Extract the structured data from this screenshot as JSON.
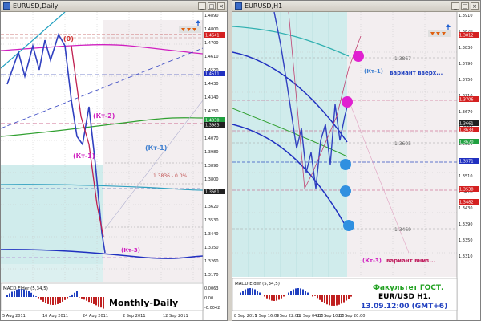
{
  "left_window": {
    "title": "EURUSD,Daily",
    "buttons": [
      "_",
      "□",
      "×"
    ],
    "label_0": "(0)",
    "label_kt2": "(Кт-2)",
    "label_kt1": "(Кт-1)",
    "label_kt1_blue": "(Кт-1)",
    "label_kt3": "(Кт-3)",
    "level_note": "1.3836 - 0.0%",
    "macd_label": "MACD Elder (5,34,5)",
    "caption": "Monthly-Daily",
    "price_ticks": [
      "1.4890",
      "1.4800",
      "1.4700",
      "1.4610",
      "1.4520",
      "1.4430",
      "1.4340",
      "1.4250",
      "1.4160",
      "1.4070",
      "1.3980",
      "1.3890",
      "1.3800",
      "1.3710",
      "1.3620",
      "1.3530",
      "1.3440",
      "1.3350",
      "1.3260",
      "1.3170"
    ],
    "price_badges": [
      {
        "text": "1.4641",
        "color": "#d42020"
      },
      {
        "text": "1.4511",
        "color": "#2030c0"
      },
      {
        "text": "1.4030",
        "color": "#20a040"
      },
      {
        "text": "1.3983",
        "color": "#202020"
      },
      {
        "text": "1.3661",
        "color": "#202020"
      }
    ],
    "macd_ticks": [
      "0.0063",
      "0.00",
      "-0.0042"
    ],
    "date_ticks": [
      "5 Aug 2011",
      "16 Aug 2011",
      "24 Aug 2011",
      "2 Sep 2011",
      "12 Sep 2011"
    ]
  },
  "right_window": {
    "title": "EURUSD,H1",
    "buttons": [
      "_",
      "□",
      "×"
    ],
    "label_kt1": "(Кт-1)",
    "label_variant_up": "вариант вверх...",
    "label_variant_down": "вариант вниз...",
    "label_kt3": "(Кт-3)",
    "level_3867": "1.3867",
    "level_3605": "1.3605",
    "level_3469": "1.3469",
    "macd_label": "MACD Elder (5,34,5)",
    "caption_line1": "Факультет ГОСТ.",
    "caption_line2": "EUR/USD H1.",
    "caption_line3": "13.09.12:00 (GMT+6)",
    "price_ticks": [
      "1.3910",
      "1.3870",
      "1.3830",
      "1.3790",
      "1.3750",
      "1.3710",
      "1.3670",
      "1.3630",
      "1.3590",
      "1.3550",
      "1.3510",
      "1.3470",
      "1.3430",
      "1.3390",
      "1.3350",
      "1.3310"
    ],
    "price_badges": [
      {
        "text": "1.3812",
        "color": "#d42020"
      },
      {
        "text": "1.3706",
        "color": "#d42020"
      },
      {
        "text": "1.3661",
        "color": "#202020"
      },
      {
        "text": "1.3633",
        "color": "#d42020"
      },
      {
        "text": "1.3620",
        "color": "#20a040"
      },
      {
        "text": "1.3571",
        "color": "#2030c0"
      },
      {
        "text": "1.3538",
        "color": "#d42020"
      },
      {
        "text": "1.3482",
        "color": "#d42020"
      }
    ],
    "date_ticks": [
      "8 Sep 2011",
      "9 Sep 16:00",
      "9 Sep 22:00",
      "12 Sep 04:00",
      "12 Sep 10:00",
      "12 Sep 20:00"
    ]
  }
}
